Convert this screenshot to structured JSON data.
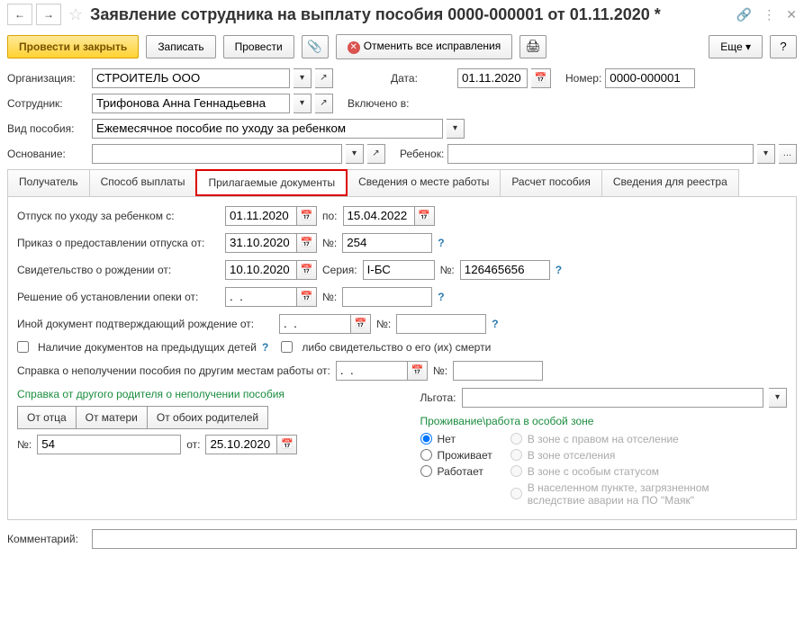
{
  "title": "Заявление сотрудника на выплату пособия 0000-000001 от 01.11.2020 *",
  "toolbar": {
    "post_close": "Провести и закрыть",
    "write": "Записать",
    "post": "Провести",
    "cancel_all": "Отменить все исправления",
    "more": "Еще"
  },
  "form": {
    "org_label": "Организация:",
    "org_value": "СТРОИТЕЛЬ ООО",
    "date_label": "Дата:",
    "date_value": "01.11.2020",
    "number_label": "Номер:",
    "number_value": "0000-000001",
    "employee_label": "Сотрудник:",
    "employee_value": "Трифонова Анна Геннадьевна",
    "included_label": "Включено в:",
    "benefit_type_label": "Вид пособия:",
    "benefit_type_value": "Ежемесячное пособие по уходу за ребенком",
    "basis_label": "Основание:",
    "child_label": "Ребенок:"
  },
  "tabs": [
    "Получатель",
    "Способ выплаты",
    "Прилагаемые документы",
    "Сведения о месте работы",
    "Расчет пособия",
    "Сведения для реестра"
  ],
  "docs": {
    "leave_from_label": "Отпуск по уходу за ребенком с:",
    "leave_from": "01.11.2020",
    "to_label": "по:",
    "leave_to": "15.04.2022",
    "order_label": "Приказ о предоставлении отпуска от:",
    "order_date": "31.10.2020",
    "no_label": "№:",
    "order_no": "254",
    "birth_cert_label": "Свидетельство о рождении от:",
    "birth_cert_date": "10.10.2020",
    "series_label": "Серия:",
    "series_value": "I-БС",
    "birth_cert_no": "126465656",
    "guardian_label": "Решение об установлении опеки от:",
    "empty_date": ".  .",
    "other_doc_label": "Иной документ подтверждающий рождение от:",
    "prev_children_label": "Наличие документов на предыдущих детей",
    "death_cert_label": "либо свидетельство о его (их) смерти",
    "no_benefit_cert_label": "Справка о неполучении пособия по другим местам работы от:",
    "other_parent_cert_label": "Справка от другого родителя о неполучении пособия",
    "from_father": "От отца",
    "from_mother": "От матери",
    "from_both": "От обоих родителей",
    "ref_no": "54",
    "ref_from_label": "от:",
    "ref_date": "25.10.2020",
    "privilege_label": "Льгота:",
    "zone_title": "Проживание\\работа в особой зоне",
    "zone_none": "Нет",
    "zone_lives": "Проживает",
    "zone_works": "Работает",
    "zone_relocation": "В зоне с правом на отселение",
    "zone_otselenie": "В зоне отселения",
    "zone_special": "В зоне с особым статусом",
    "zone_mayak": "В населенном пункте, загрязненном вследствие аварии на ПО \"Маяк\""
  },
  "comment_label": "Комментарий:"
}
